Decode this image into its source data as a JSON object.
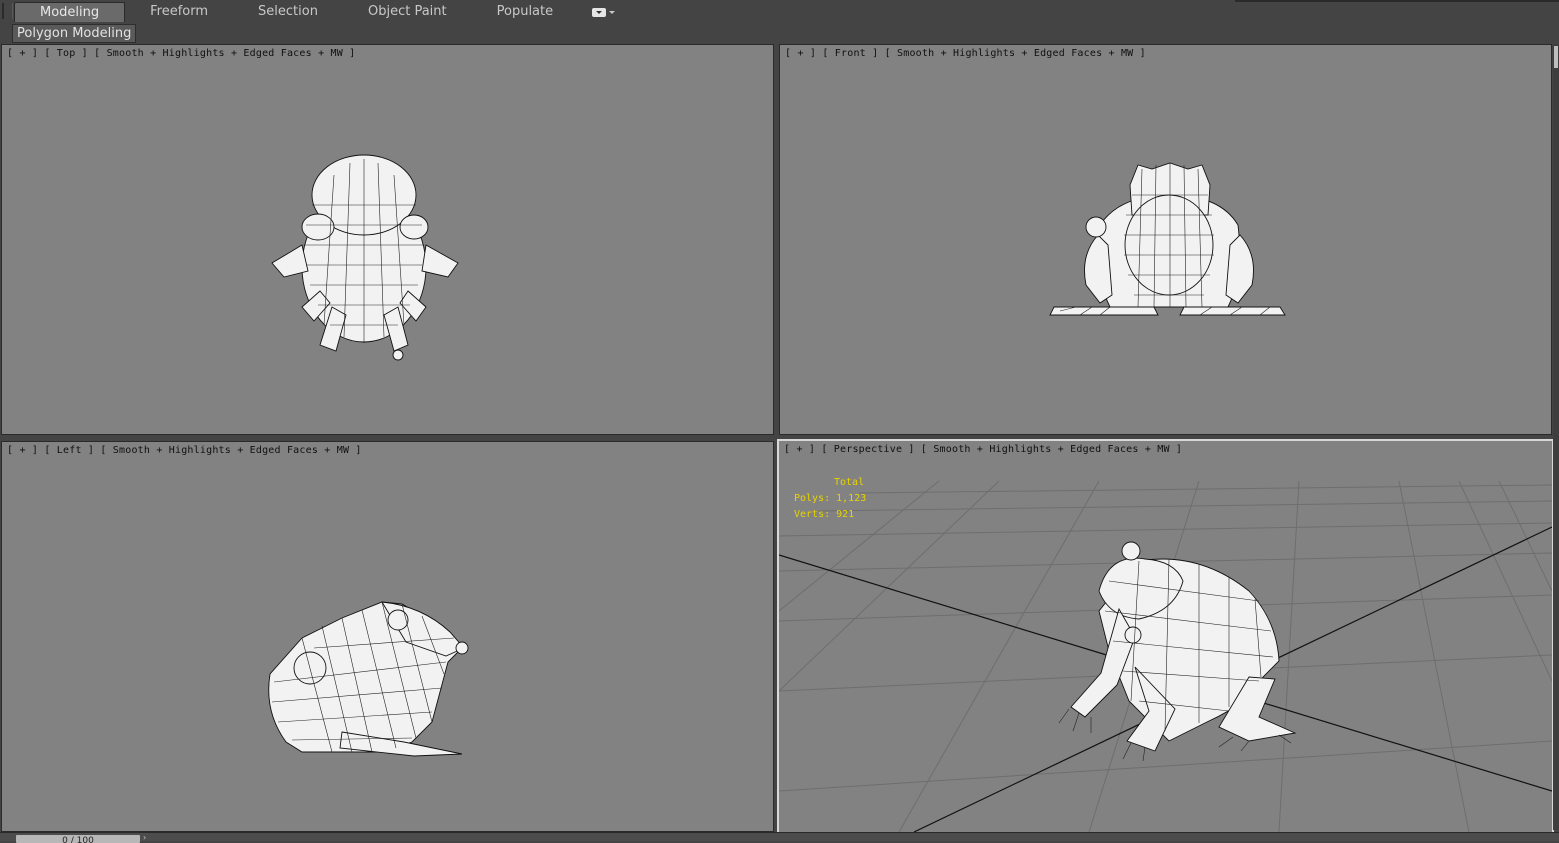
{
  "ribbon": {
    "tabs": [
      "Modeling",
      "Freeform",
      "Selection",
      "Object Paint",
      "Populate"
    ],
    "active_tab": "Modeling",
    "options_icon": "ribbon-options-icon",
    "panel_label": "Polygon Modeling"
  },
  "viewports": {
    "top": {
      "plus": "[ + ]",
      "view": "[ Top ]",
      "shading": "[ Smooth + Highlights + Edged Faces + MW ]"
    },
    "front": {
      "plus": "[ + ]",
      "view": "[ Front ]",
      "shading": "[ Smooth + Highlights + Edged Faces + MW ]"
    },
    "left": {
      "plus": "[ + ]",
      "view": "[ Left ]",
      "shading": "[ Smooth + Highlights + Edged Faces + MW ]"
    },
    "perspective": {
      "plus": "[ + ]",
      "view": "[ Perspective ]",
      "shading": "[ Smooth + Highlights + Edged Faces + MW ]"
    }
  },
  "stats": {
    "total_label": "Total",
    "polys": "Polys: 1,123",
    "verts": "Verts: 921"
  },
  "time_slider": {
    "label": "0 / 100"
  },
  "colors": {
    "viewport_bg": "#828282",
    "active_border": "#d8d8d8",
    "stats_text": "#e8d400",
    "ui_bg": "#444444"
  },
  "icons": [
    "frog-model",
    "home-grid",
    "ribbon-options-icon"
  ]
}
